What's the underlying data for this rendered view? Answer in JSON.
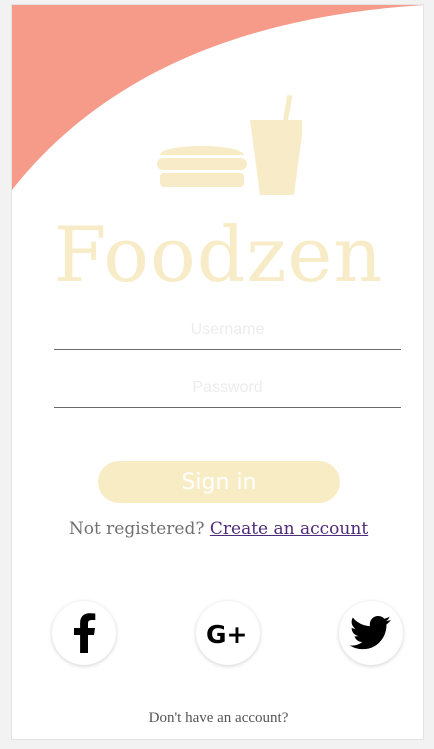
{
  "brand": {
    "title": "Foodzen",
    "logo_icon": "burger-and-drink-icon",
    "title_color": "#f7ecc7",
    "accent_wave_color": "#f69b8a"
  },
  "login_form": {
    "username_placeholder": "Username",
    "password_placeholder": "Password",
    "signin_label": "Sign in",
    "signin_button_color": "#f8ecc4"
  },
  "register": {
    "prompt": "Not registered? ",
    "link_label": "Create an account",
    "link_color": "#4f2a7a"
  },
  "social_login": [
    {
      "name": "facebook",
      "icon": "facebook-icon"
    },
    {
      "name": "google-plus",
      "icon": "google-plus-icon"
    },
    {
      "name": "twitter",
      "icon": "twitter-icon"
    }
  ],
  "footer": {
    "text": "Don't have an account?"
  }
}
